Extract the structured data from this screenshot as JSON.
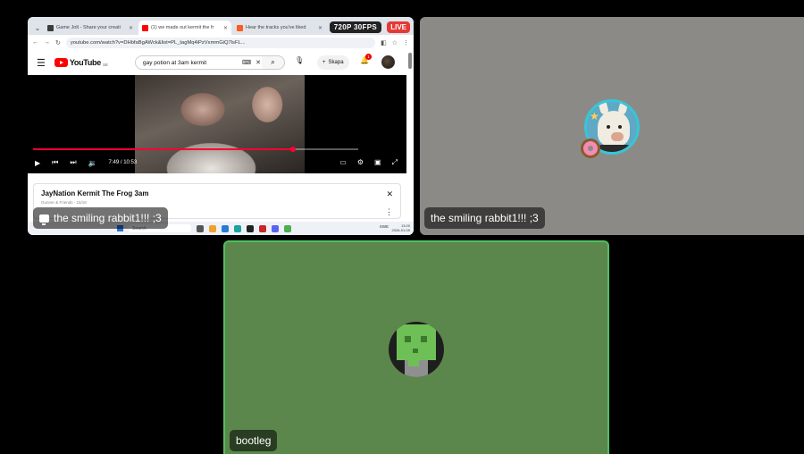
{
  "browser": {
    "tabs": [
      {
        "title": "Game Jolt - Share your creati",
        "fav_color": "#3b3b3b",
        "active": false
      },
      {
        "title": "(1) we made out kermit the fr",
        "fav_color": "#ff0000",
        "active": true
      },
      {
        "title": "Hear the tracks you've liked",
        "fav_color": "#ff5a1f",
        "active": false
      }
    ],
    "url": "youtube.com/watch?v=DHbfaBgAWck&list=PL_tagMq4iPzVxmmGiQ7lsFL..."
  },
  "stream": {
    "quality": "720P 30FPS",
    "live": "LIVE"
  },
  "youtube": {
    "logo_text": "YouTube",
    "region": "SE",
    "search_query": "gay potion at 3am kermit",
    "create_label": "Skapa",
    "notif_count": "1",
    "player": {
      "time": "7:49 / 10:53",
      "progress": 0.8
    },
    "video": {
      "title": "JayNation Kermit The Frog 3am",
      "subtitle": "Gunner & Friends - 15/18"
    }
  },
  "taskbar": {
    "search_placeholder": "Search",
    "tray": "SWE",
    "clock_time": "13:20",
    "clock_date": "2026-01-09"
  },
  "participants": [
    {
      "name": "the smiling rabbit1!!! ;3",
      "tile": "screen-share"
    },
    {
      "name": "the smiling rabbit1!!! ;3",
      "tile": "camera"
    },
    {
      "name": "bootleg",
      "tile": "camera",
      "speaking": true
    }
  ],
  "colors": {
    "background": "#000000",
    "rabbit_tile": "#8c8a87",
    "bootleg_tile": "#5c874c",
    "speaking_border": "#4fbf62",
    "live_red": "#e53935",
    "yt_red": "#ff0033"
  },
  "icons": [
    "screen-share-icon",
    "play-icon",
    "skip-prev-icon",
    "skip-next-icon",
    "volume-icon",
    "subtitles-icon",
    "settings-icon",
    "miniplayer-icon",
    "fullscreen-icon",
    "search-icon",
    "mic-icon",
    "bell-icon",
    "close-icon"
  ]
}
